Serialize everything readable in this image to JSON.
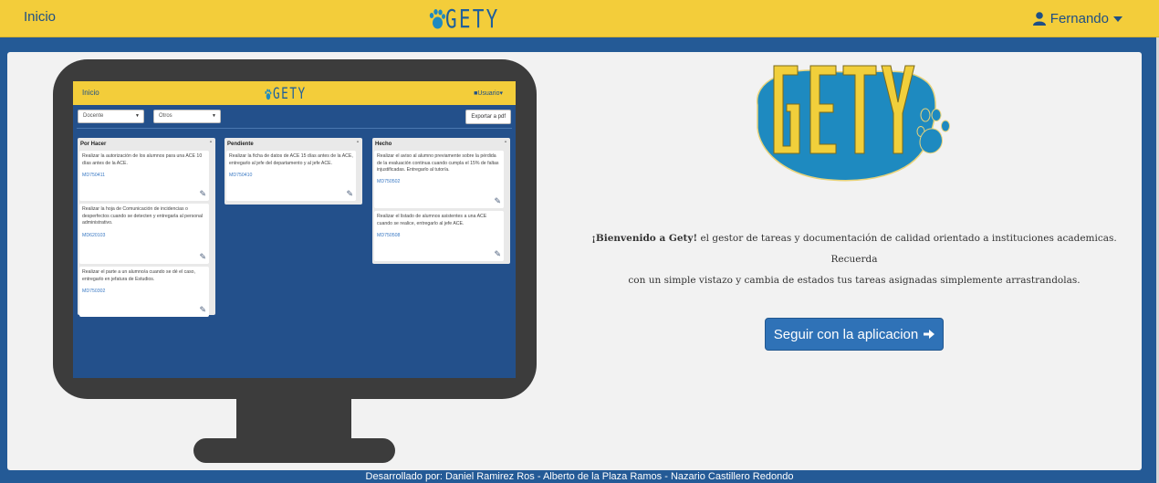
{
  "navbar": {
    "home_label": "Inicio",
    "brand": "GETY",
    "user_label": "Fernando"
  },
  "preview": {
    "home_label": "Inicio",
    "brand": "GETY",
    "user_label": "Usuario",
    "select_role": "Docente",
    "select_other": "Otros",
    "export_label": "Exportar a pdf",
    "columns": [
      {
        "title": "Por Hacer",
        "cards": [
          {
            "text": "Realizar la autorización de los alumnos para una ACE 10 días antes de la ACE.",
            "id": "MD750411"
          },
          {
            "text": "Realizar la hoja de Comunicación de incidencias o desperfectos cuando se detecten y entregarla al personal administrativo.",
            "id": "MD620103"
          },
          {
            "text": "Realizar el parte a un alumno/a cuando se dé el caso, entregarlo en jefatura de Estudios.",
            "id": "MD750302"
          }
        ]
      },
      {
        "title": "Pendiente",
        "cards": [
          {
            "text": "Realizar la ficha de datos de ACE 15 días antes de la ACE, entregarlo al jefe del departamento y al jefe ACE.",
            "id": "MD750410"
          }
        ]
      },
      {
        "title": "Hecho",
        "cards": [
          {
            "text": "Realizar el aviso al alumno previamente sobre la pérdida de la evaluación continua cuando cumpla el 15% de faltas injustificadas. Entregarlo al tutor/a.",
            "id": "MD750502"
          },
          {
            "text": "Realizar el listado de alumnos asistentes a una ACE cuando se realice, entregarlo al jefe ACE.",
            "id": "MD750508"
          }
        ]
      }
    ]
  },
  "welcome": {
    "bold": "¡Bienvenido a Gety!",
    "line1_rest": " el gestor de tareas y documentación de calidad orientado a instituciones academicas. Recuerda",
    "line2": "con un simple vistazo y cambia de estados tus tareas asignadas simplemente arrastrandolas."
  },
  "cta_label": "Seguir con la aplicacion",
  "footer_text": "Desarrollado por: Daniel Ramirez Ros - Alberto de la Plaza Ramos - Nazario Castillero Redondo",
  "colors": {
    "navbar": "#f3cd3a",
    "background": "#245a96",
    "panel": "#f2f2f2",
    "button": "#2f72b7",
    "monitor": "#3c3c3c",
    "logo_blob": "#1e8ac0"
  }
}
